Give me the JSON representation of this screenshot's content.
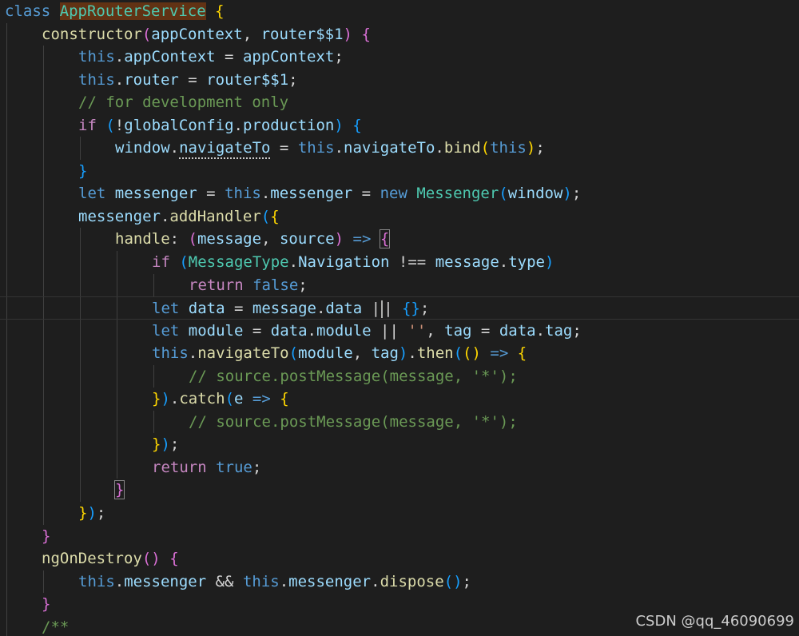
{
  "editor": {
    "theme": "dark",
    "background": "#1e1e1e",
    "colors": {
      "keyword": "#569cd6",
      "control": "#c586c0",
      "function": "#dcdcaa",
      "variable": "#9cdcfe",
      "class": "#4ec9b0",
      "string": "#ce9178",
      "comment": "#6a9955",
      "bracket_level1": "#ffd700",
      "bracket_level2": "#da70d6",
      "bracket_level3": "#179fff"
    },
    "lines": [
      {
        "indent": 0,
        "tokens": [
          {
            "t": "class",
            "c": "kw"
          },
          {
            "t": " ",
            "c": "txt"
          },
          {
            "t": "AppRouterService",
            "c": "cls",
            "hl": "class"
          },
          {
            "t": " ",
            "c": "txt"
          },
          {
            "t": "{",
            "c": "b1"
          }
        ]
      },
      {
        "indent": 1,
        "tokens": [
          {
            "t": "constructor",
            "c": "fn"
          },
          {
            "t": "(",
            "c": "b2"
          },
          {
            "t": "appContext",
            "c": "var"
          },
          {
            "t": ", ",
            "c": "txt"
          },
          {
            "t": "router$$1",
            "c": "var"
          },
          {
            "t": ")",
            "c": "b2"
          },
          {
            "t": " ",
            "c": "txt"
          },
          {
            "t": "{",
            "c": "b2"
          }
        ]
      },
      {
        "indent": 2,
        "tokens": [
          {
            "t": "this",
            "c": "kw"
          },
          {
            "t": ".",
            "c": "txt"
          },
          {
            "t": "appContext",
            "c": "var"
          },
          {
            "t": " = ",
            "c": "txt"
          },
          {
            "t": "appContext",
            "c": "var"
          },
          {
            "t": ";",
            "c": "txt"
          }
        ]
      },
      {
        "indent": 2,
        "tokens": [
          {
            "t": "this",
            "c": "kw"
          },
          {
            "t": ".",
            "c": "txt"
          },
          {
            "t": "router",
            "c": "var"
          },
          {
            "t": " = ",
            "c": "txt"
          },
          {
            "t": "router$$1",
            "c": "var"
          },
          {
            "t": ";",
            "c": "txt"
          }
        ]
      },
      {
        "indent": 2,
        "tokens": [
          {
            "t": "// for development only",
            "c": "cmt"
          }
        ]
      },
      {
        "indent": 2,
        "tokens": [
          {
            "t": "if",
            "c": "ctl"
          },
          {
            "t": " ",
            "c": "txt"
          },
          {
            "t": "(",
            "c": "b3"
          },
          {
            "t": "!",
            "c": "txt"
          },
          {
            "t": "globalConfig",
            "c": "var"
          },
          {
            "t": ".",
            "c": "txt"
          },
          {
            "t": "production",
            "c": "var"
          },
          {
            "t": ")",
            "c": "b3"
          },
          {
            "t": " ",
            "c": "txt"
          },
          {
            "t": "{",
            "c": "b3"
          }
        ]
      },
      {
        "indent": 3,
        "tokens": [
          {
            "t": "window",
            "c": "var"
          },
          {
            "t": ".",
            "c": "txt"
          },
          {
            "t": "navigateTo",
            "c": "var",
            "squiggle": true
          },
          {
            "t": " = ",
            "c": "txt"
          },
          {
            "t": "this",
            "c": "kw"
          },
          {
            "t": ".",
            "c": "txt"
          },
          {
            "t": "navigateTo",
            "c": "var"
          },
          {
            "t": ".",
            "c": "txt"
          },
          {
            "t": "bind",
            "c": "fn"
          },
          {
            "t": "(",
            "c": "b1"
          },
          {
            "t": "this",
            "c": "kw"
          },
          {
            "t": ")",
            "c": "b1"
          },
          {
            "t": ";",
            "c": "txt"
          }
        ]
      },
      {
        "indent": 2,
        "tokens": [
          {
            "t": "}",
            "c": "b3"
          }
        ]
      },
      {
        "indent": 2,
        "tokens": [
          {
            "t": "let",
            "c": "kw"
          },
          {
            "t": " ",
            "c": "txt"
          },
          {
            "t": "messenger",
            "c": "var"
          },
          {
            "t": " = ",
            "c": "txt"
          },
          {
            "t": "this",
            "c": "kw"
          },
          {
            "t": ".",
            "c": "txt"
          },
          {
            "t": "messenger",
            "c": "var"
          },
          {
            "t": " = ",
            "c": "txt"
          },
          {
            "t": "new",
            "c": "kw"
          },
          {
            "t": " ",
            "c": "txt"
          },
          {
            "t": "Messenger",
            "c": "cls"
          },
          {
            "t": "(",
            "c": "b3"
          },
          {
            "t": "window",
            "c": "var"
          },
          {
            "t": ")",
            "c": "b3"
          },
          {
            "t": ";",
            "c": "txt"
          }
        ]
      },
      {
        "indent": 2,
        "tokens": [
          {
            "t": "messenger",
            "c": "var"
          },
          {
            "t": ".",
            "c": "txt"
          },
          {
            "t": "addHandler",
            "c": "fn"
          },
          {
            "t": "(",
            "c": "b3"
          },
          {
            "t": "{",
            "c": "b1"
          }
        ]
      },
      {
        "indent": 3,
        "tokens": [
          {
            "t": "handle",
            "c": "fn"
          },
          {
            "t": ": ",
            "c": "txt"
          },
          {
            "t": "(",
            "c": "b2"
          },
          {
            "t": "message",
            "c": "var"
          },
          {
            "t": ", ",
            "c": "txt"
          },
          {
            "t": "source",
            "c": "var"
          },
          {
            "t": ")",
            "c": "b2"
          },
          {
            "t": " ",
            "c": "txt"
          },
          {
            "t": "=>",
            "c": "kw"
          },
          {
            "t": " ",
            "c": "txt"
          },
          {
            "t": "{",
            "c": "b2",
            "box": true
          }
        ]
      },
      {
        "indent": 4,
        "tokens": [
          {
            "t": "if",
            "c": "ctl"
          },
          {
            "t": " ",
            "c": "txt"
          },
          {
            "t": "(",
            "c": "b3"
          },
          {
            "t": "MessageType",
            "c": "cls"
          },
          {
            "t": ".",
            "c": "txt"
          },
          {
            "t": "Navigation",
            "c": "var"
          },
          {
            "t": " !== ",
            "c": "txt"
          },
          {
            "t": "message",
            "c": "var"
          },
          {
            "t": ".",
            "c": "txt"
          },
          {
            "t": "type",
            "c": "var"
          },
          {
            "t": ")",
            "c": "b3"
          }
        ]
      },
      {
        "indent": 5,
        "tokens": [
          {
            "t": "return",
            "c": "ctl"
          },
          {
            "t": " ",
            "c": "txt"
          },
          {
            "t": "false",
            "c": "kw"
          },
          {
            "t": ";",
            "c": "txt"
          }
        ]
      },
      {
        "indent": 4,
        "current": true,
        "tokens": [
          {
            "t": "let",
            "c": "kw"
          },
          {
            "t": " ",
            "c": "txt"
          },
          {
            "t": "data",
            "c": "var"
          },
          {
            "t": " = ",
            "c": "txt"
          },
          {
            "t": "message",
            "c": "var"
          },
          {
            "t": ".",
            "c": "txt"
          },
          {
            "t": "data",
            "c": "var"
          },
          {
            "t": " ",
            "c": "txt"
          },
          {
            "t": "|",
            "c": "txt"
          },
          {
            "cursor": true
          },
          {
            "t": "|",
            "c": "txt"
          },
          {
            "t": " ",
            "c": "txt"
          },
          {
            "t": "{}",
            "c": "b3"
          },
          {
            "t": ";",
            "c": "txt"
          }
        ]
      },
      {
        "indent": 4,
        "tokens": [
          {
            "t": "let",
            "c": "kw"
          },
          {
            "t": " ",
            "c": "txt"
          },
          {
            "t": "module",
            "c": "var"
          },
          {
            "t": " = ",
            "c": "txt"
          },
          {
            "t": "data",
            "c": "var"
          },
          {
            "t": ".",
            "c": "txt"
          },
          {
            "t": "module",
            "c": "var"
          },
          {
            "t": " || ",
            "c": "txt"
          },
          {
            "t": "''",
            "c": "str"
          },
          {
            "t": ", ",
            "c": "txt"
          },
          {
            "t": "tag",
            "c": "var"
          },
          {
            "t": " = ",
            "c": "txt"
          },
          {
            "t": "data",
            "c": "var"
          },
          {
            "t": ".",
            "c": "txt"
          },
          {
            "t": "tag",
            "c": "var"
          },
          {
            "t": ";",
            "c": "txt"
          }
        ]
      },
      {
        "indent": 4,
        "tokens": [
          {
            "t": "this",
            "c": "kw"
          },
          {
            "t": ".",
            "c": "txt"
          },
          {
            "t": "navigateTo",
            "c": "fn"
          },
          {
            "t": "(",
            "c": "b3"
          },
          {
            "t": "module",
            "c": "var"
          },
          {
            "t": ", ",
            "c": "txt"
          },
          {
            "t": "tag",
            "c": "var"
          },
          {
            "t": ")",
            "c": "b3"
          },
          {
            "t": ".",
            "c": "txt"
          },
          {
            "t": "then",
            "c": "fn"
          },
          {
            "t": "(",
            "c": "b3"
          },
          {
            "t": "()",
            "c": "b1"
          },
          {
            "t": " ",
            "c": "txt"
          },
          {
            "t": "=>",
            "c": "kw"
          },
          {
            "t": " ",
            "c": "txt"
          },
          {
            "t": "{",
            "c": "b1"
          }
        ]
      },
      {
        "indent": 5,
        "tokens": [
          {
            "t": "// source.postMessage(message, '*');",
            "c": "cmt"
          }
        ]
      },
      {
        "indent": 4,
        "tokens": [
          {
            "t": "}",
            "c": "b1"
          },
          {
            "t": ")",
            "c": "b3"
          },
          {
            "t": ".",
            "c": "txt"
          },
          {
            "t": "catch",
            "c": "fn"
          },
          {
            "t": "(",
            "c": "b3"
          },
          {
            "t": "e",
            "c": "var"
          },
          {
            "t": " ",
            "c": "txt"
          },
          {
            "t": "=>",
            "c": "kw"
          },
          {
            "t": " ",
            "c": "txt"
          },
          {
            "t": "{",
            "c": "b1"
          }
        ]
      },
      {
        "indent": 5,
        "tokens": [
          {
            "t": "// source.postMessage(message, '*');",
            "c": "cmt"
          }
        ]
      },
      {
        "indent": 4,
        "tokens": [
          {
            "t": "}",
            "c": "b1"
          },
          {
            "t": ")",
            "c": "b3"
          },
          {
            "t": ";",
            "c": "txt"
          }
        ]
      },
      {
        "indent": 4,
        "tokens": [
          {
            "t": "return",
            "c": "ctl"
          },
          {
            "t": " ",
            "c": "txt"
          },
          {
            "t": "true",
            "c": "kw"
          },
          {
            "t": ";",
            "c": "txt"
          }
        ]
      },
      {
        "indent": 3,
        "tokens": [
          {
            "t": "}",
            "c": "b2",
            "box": true
          }
        ]
      },
      {
        "indent": 2,
        "tokens": [
          {
            "t": "}",
            "c": "b1"
          },
          {
            "t": ")",
            "c": "b3"
          },
          {
            "t": ";",
            "c": "txt"
          }
        ]
      },
      {
        "indent": 1,
        "tokens": [
          {
            "t": "}",
            "c": "b2"
          }
        ]
      },
      {
        "indent": 1,
        "tokens": [
          {
            "t": "ngOnDestroy",
            "c": "fn"
          },
          {
            "t": "()",
            "c": "b2"
          },
          {
            "t": " ",
            "c": "txt"
          },
          {
            "t": "{",
            "c": "b2"
          }
        ]
      },
      {
        "indent": 2,
        "tokens": [
          {
            "t": "this",
            "c": "kw"
          },
          {
            "t": ".",
            "c": "txt"
          },
          {
            "t": "messenger",
            "c": "var"
          },
          {
            "t": " && ",
            "c": "txt"
          },
          {
            "t": "this",
            "c": "kw"
          },
          {
            "t": ".",
            "c": "txt"
          },
          {
            "t": "messenger",
            "c": "var"
          },
          {
            "t": ".",
            "c": "txt"
          },
          {
            "t": "dispose",
            "c": "fn"
          },
          {
            "t": "()",
            "c": "b3"
          },
          {
            "t": ";",
            "c": "txt"
          }
        ]
      },
      {
        "indent": 1,
        "tokens": [
          {
            "t": "}",
            "c": "b2"
          }
        ]
      },
      {
        "indent": 1,
        "tokens": [
          {
            "t": "/**",
            "c": "cmt"
          }
        ]
      }
    ]
  },
  "watermark": {
    "text": "CSDN @qq_46090699"
  }
}
